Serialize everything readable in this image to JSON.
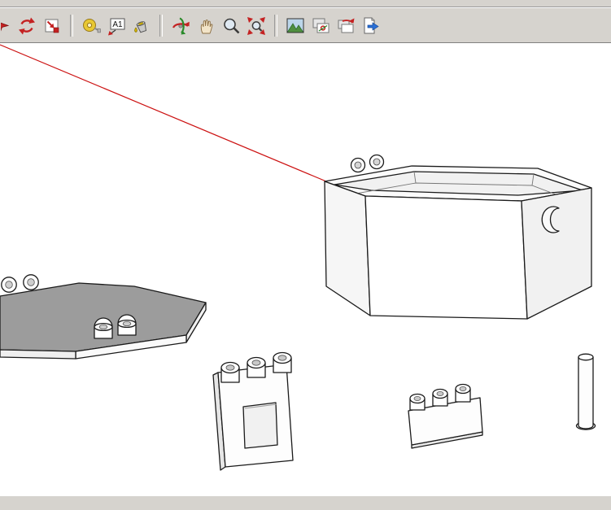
{
  "toolbar": {
    "background_color": "#d6d3ce",
    "dimension_label": "A1",
    "icons": [
      {
        "name": "select-cursor-icon"
      },
      {
        "name": "reload-icon"
      },
      {
        "name": "import-model-icon"
      },
      {
        "name": "tape-measure-icon"
      },
      {
        "name": "dimension-icon",
        "label": "A1"
      },
      {
        "name": "paint-bucket-icon"
      },
      {
        "name": "orbit-icon"
      },
      {
        "name": "pan-icon"
      },
      {
        "name": "zoom-icon"
      },
      {
        "name": "zoom-extents-icon"
      },
      {
        "name": "terrain-photo-icon"
      },
      {
        "name": "photo-match-icon"
      },
      {
        "name": "photo-rotate-icon"
      },
      {
        "name": "export-icon"
      }
    ]
  },
  "viewport": {
    "background_color": "#ffffff",
    "axis_color": "#cc1111",
    "edge_color": "#1a1a1a",
    "objects": [
      {
        "name": "open-hexagonal-box",
        "face_color": "#ffffff",
        "details": "open hex box, two hinge knuckle rings on rim, crescent cutout on right face"
      },
      {
        "name": "hexagonal-lid",
        "top_color": "#9c9c9c",
        "details": "gray hex lid, two knuckle rings at left edge, two knuckles at front edge"
      },
      {
        "name": "hinge-plate-with-square-hole",
        "knuckle_count": 3
      },
      {
        "name": "hinge-strip",
        "knuckle_count": 3
      },
      {
        "name": "cylindrical-pin"
      }
    ]
  },
  "statusbar": {
    "text": ""
  }
}
